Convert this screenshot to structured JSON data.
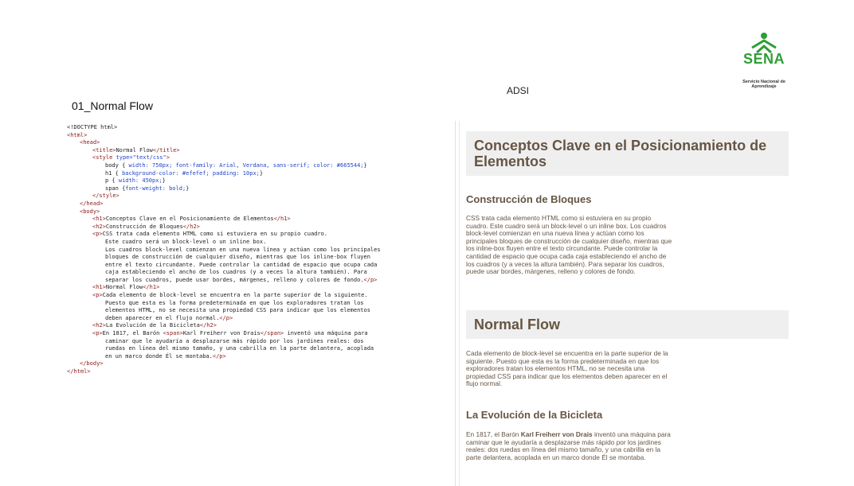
{
  "header": {
    "logo_text": "SENA",
    "logo_subtitle": "Servicio Nacional de Aprendizaje",
    "program": "ADSI",
    "document_title": "01_Normal Flow"
  },
  "code_lines": [
    {
      "indent": 0,
      "parts": [
        [
          "plain",
          "<!DOCTYPE html>"
        ]
      ]
    },
    {
      "indent": 0,
      "parts": [
        [
          "tag",
          "<html>"
        ]
      ]
    },
    {
      "indent": 1,
      "parts": [
        [
          "tag",
          "<head>"
        ]
      ]
    },
    {
      "indent": 2,
      "parts": [
        [
          "tag",
          "<title>"
        ],
        [
          "text",
          "Normal Flow"
        ],
        [
          "tag",
          "</title>"
        ]
      ]
    },
    {
      "indent": 2,
      "parts": [
        [
          "tag",
          "<style "
        ],
        [
          "css",
          "type=\"text/css\""
        ],
        [
          "tag",
          ">"
        ]
      ]
    },
    {
      "indent": 3,
      "parts": [
        [
          "text",
          "body { "
        ],
        [
          "css",
          "width: 750px; font-family: Arial, Verdana, sans-serif; color: #665544;"
        ],
        [
          "text",
          "}"
        ]
      ]
    },
    {
      "indent": 3,
      "parts": [
        [
          "text",
          "h1 { "
        ],
        [
          "css",
          "background-color: #efefef; padding: 10px;"
        ],
        [
          "text",
          "}"
        ]
      ]
    },
    {
      "indent": 3,
      "parts": [
        [
          "text",
          "p { "
        ],
        [
          "css",
          "width: 450px;"
        ],
        [
          "text",
          "}"
        ]
      ]
    },
    {
      "indent": 3,
      "parts": [
        [
          "text",
          "span {"
        ],
        [
          "css",
          "font-weight: bold;"
        ],
        [
          "text",
          "}"
        ]
      ]
    },
    {
      "indent": 2,
      "parts": [
        [
          "tag",
          "</style>"
        ]
      ]
    },
    {
      "indent": 1,
      "parts": [
        [
          "tag",
          "</head>"
        ]
      ]
    },
    {
      "indent": 1,
      "parts": [
        [
          "tag",
          "<body>"
        ]
      ]
    },
    {
      "indent": 2,
      "parts": [
        [
          "tag",
          "<h1>"
        ],
        [
          "text",
          "Conceptos Clave en el Posicionamiento de Elementos"
        ],
        [
          "tag",
          "</h1>"
        ]
      ]
    },
    {
      "indent": 2,
      "parts": [
        [
          "tag",
          "<h2>"
        ],
        [
          "text",
          "Construcción de Bloques"
        ],
        [
          "tag",
          "</h2>"
        ]
      ]
    },
    {
      "indent": 2,
      "parts": [
        [
          "tag",
          "<p>"
        ],
        [
          "text",
          "CSS trata cada elemento HTML como si estuviera en su propio cuadro."
        ]
      ]
    },
    {
      "indent": 3,
      "parts": [
        [
          "text",
          "Este cuadro será un block-level o un inline box."
        ]
      ]
    },
    {
      "indent": 3,
      "parts": [
        [
          "text",
          "Los cuadros block-level comienzan en una nueva línea y actúan como los principales"
        ]
      ]
    },
    {
      "indent": 3,
      "parts": [
        [
          "text",
          "bloques de construcción de cualquier diseño, mientras que los inline-box fluyen"
        ]
      ]
    },
    {
      "indent": 3,
      "parts": [
        [
          "text",
          "entre el texto circundante. Puede controlar la cantidad de espacio que ocupa cada"
        ]
      ]
    },
    {
      "indent": 3,
      "parts": [
        [
          "text",
          "caja estableciendo el ancho de los cuadros (y a veces la altura también). Para"
        ]
      ]
    },
    {
      "indent": 3,
      "parts": [
        [
          "text",
          "separar los cuadros, puede usar bordes, márgenes, relleno y colores de fondo."
        ],
        [
          "tag",
          "</p>"
        ]
      ]
    },
    {
      "indent": 2,
      "parts": [
        [
          "tag",
          "<h1>"
        ],
        [
          "text",
          "Normal Flow"
        ],
        [
          "tag",
          "</h1>"
        ]
      ]
    },
    {
      "indent": 2,
      "parts": [
        [
          "tag",
          "<p>"
        ],
        [
          "text",
          "Cada elemento de block-level se encuentra en la parte superior de la siguiente."
        ]
      ]
    },
    {
      "indent": 3,
      "parts": [
        [
          "text",
          "Puesto que esta es la forma predeterminada en que los exploradores tratan los"
        ]
      ]
    },
    {
      "indent": 3,
      "parts": [
        [
          "text",
          "elementos HTML, no se necesita una propiedad CSS para indicar que los elementos"
        ]
      ]
    },
    {
      "indent": 3,
      "parts": [
        [
          "text",
          "deben aparecer en el flujo normal."
        ],
        [
          "tag",
          "</p>"
        ]
      ]
    },
    {
      "indent": 2,
      "parts": [
        [
          "tag",
          "<h2>"
        ],
        [
          "text",
          "La Evolución de la Bicicleta"
        ],
        [
          "tag",
          "</h2>"
        ]
      ]
    },
    {
      "indent": 2,
      "parts": [
        [
          "tag",
          "<p>"
        ],
        [
          "text",
          "En 1817, el Barón "
        ],
        [
          "tag",
          "<span>"
        ],
        [
          "text",
          "Karl Freiherr von Drais"
        ],
        [
          "tag",
          "</span>"
        ],
        [
          "text",
          " inventó una máquina para"
        ]
      ]
    },
    {
      "indent": 3,
      "parts": [
        [
          "text",
          "caminar que le ayudaría a desplazarse más rápido por los jardines reales: dos"
        ]
      ]
    },
    {
      "indent": 3,
      "parts": [
        [
          "text",
          "ruedas en línea del mismo tamaño, y una cabrilla en la parte delantera, acoplada"
        ]
      ]
    },
    {
      "indent": 3,
      "parts": [
        [
          "text",
          "en un marco donde Él se montaba."
        ],
        [
          "tag",
          "</p>"
        ]
      ]
    },
    {
      "indent": 1,
      "parts": [
        [
          "tag",
          "</body>"
        ]
      ]
    },
    {
      "indent": 0,
      "parts": [
        [
          "tag",
          "</html>"
        ]
      ]
    }
  ],
  "render": {
    "h1_a": "Conceptos Clave en el Posicionamiento de Elementos",
    "h2_a": "Construcción de Bloques",
    "p_a": "CSS trata cada elemento HTML como si estuviera en su propio cuadro. Este cuadro será un block-level o un inline box. Los cuadros block-level comienzan en una nueva línea y actúan como los principales bloques de construcción de cualquier diseño, mientras que los inline-box fluyen entre el texto circundante. Puede controlar la cantidad de espacio que ocupa cada caja estableciendo el ancho de los cuadros (y a veces la altura también). Para separar los cuadros, puede usar bordes, márgenes, relleno y colores de fondo.",
    "h1_b": "Normal Flow",
    "p_b": "Cada elemento de block-level se encuentra en la parte superior de la siguiente. Puesto que esta es la forma predeterminada en que los exploradores tratan los elementos HTML, no se necesita una propiedad CSS para indicar que los elementos deben aparecer en el flujo normal.",
    "h2_b": "La Evolución de la Bicicleta",
    "p_c_before": "En 1817, el Barón ",
    "p_c_bold": "Karl Freiherr von Drais",
    "p_c_after": " inventó una máquina para caminar que le ayudaría a desplazarse más rápido por los jardines reales: dos ruedas en línea del mismo tamaño, y una cabrilla en la parte delantera, acoplada en un marco donde Él se montaba."
  }
}
